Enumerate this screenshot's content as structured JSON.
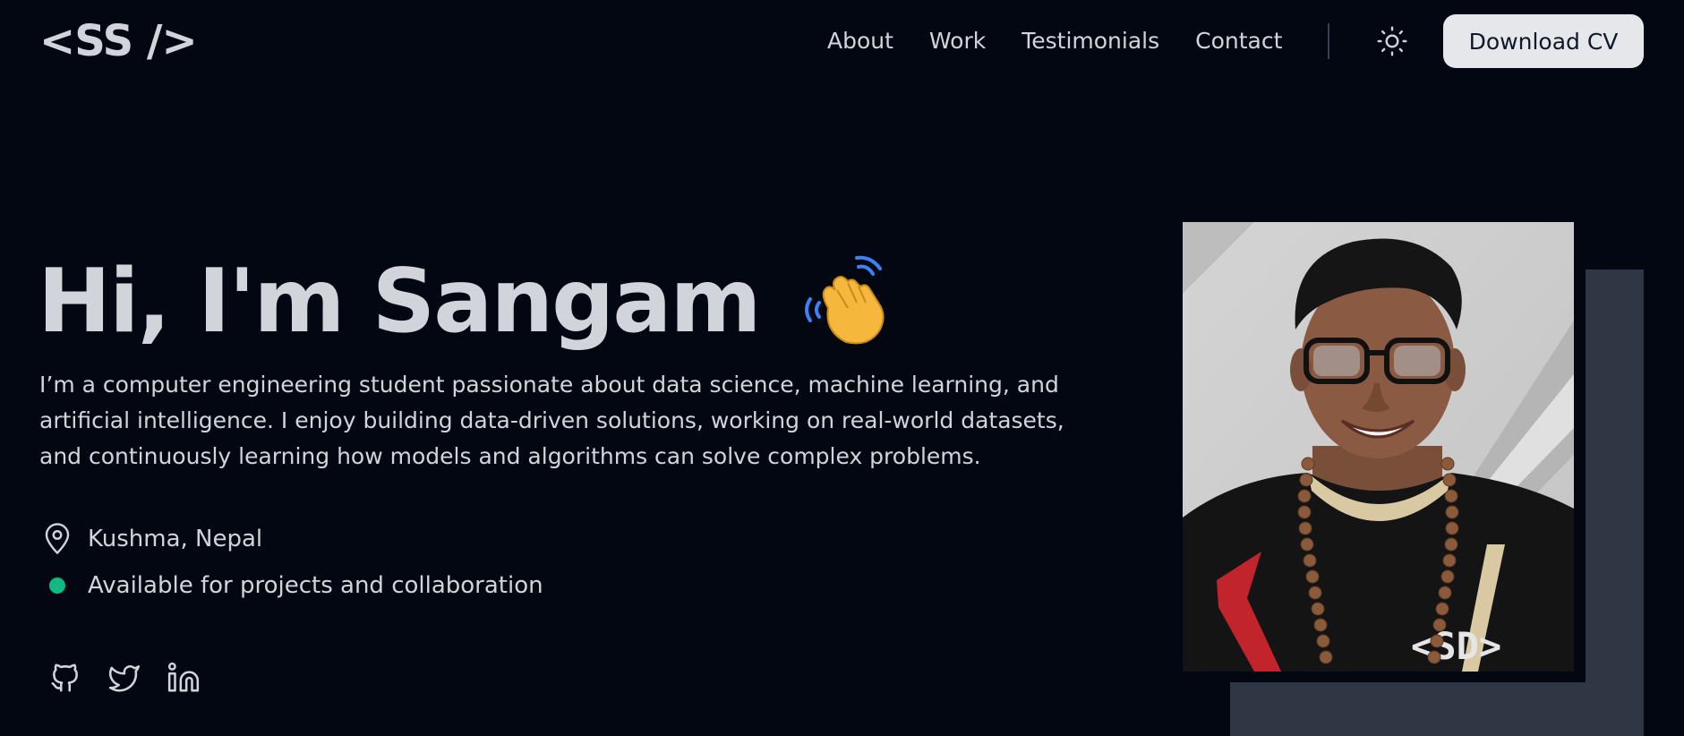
{
  "header": {
    "logo": "<SS />",
    "nav": [
      {
        "label": "About"
      },
      {
        "label": "Work"
      },
      {
        "label": "Testimonials"
      },
      {
        "label": "Contact"
      }
    ],
    "theme_toggle_icon": "sun-icon",
    "download_label": "Download CV"
  },
  "hero": {
    "title": "Hi, I'm Sangam",
    "emoji_icon": "waving-hand-icon",
    "description": "I’m a computer engineering student passionate about data science, machine learning, and artificial intelligence. I enjoy building data-driven solutions, working on real-world datasets, and continuously learning how models and algorithms can solve complex problems.",
    "location": "Kushma, Nepal",
    "location_icon": "map-pin-icon",
    "status": "Available for projects and collaboration",
    "status_color": "#10b981",
    "socials": [
      {
        "icon": "github-icon"
      },
      {
        "icon": "twitter-icon"
      },
      {
        "icon": "linkedin-icon"
      }
    ]
  },
  "colors": {
    "background": "#030712",
    "text": "#d1d5db",
    "button_bg": "#e5e7eb",
    "photo_backdrop": "#2f3744"
  }
}
